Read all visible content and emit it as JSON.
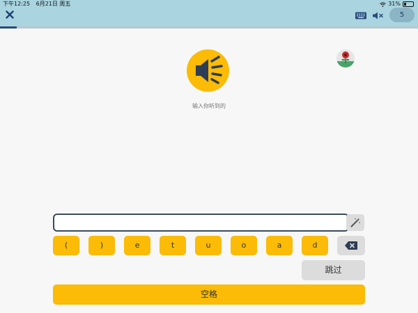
{
  "status_bar": {
    "time": "下午12:25",
    "date": "6月21日 周五",
    "battery_percent": "31%"
  },
  "header": {
    "close_icon": "close-icon",
    "keyboard_icon": "keyboard-icon",
    "mute_icon": "speaker-mute-icon",
    "count": "5",
    "progress": 0.04
  },
  "main": {
    "speaker_icon": "speaker-icon",
    "prompt": "输入你听到的",
    "answer_value": "",
    "keys": [
      "(",
      ")",
      "e",
      "t",
      "u",
      "o",
      "a",
      "d"
    ],
    "skip_label": "跳过",
    "space_label": "空格"
  },
  "colors": {
    "accent": "#fbbb06",
    "header_bg": "#a9d4e0",
    "neutral_button": "#dcdcdc",
    "dark_blue": "#2a4a7a"
  }
}
